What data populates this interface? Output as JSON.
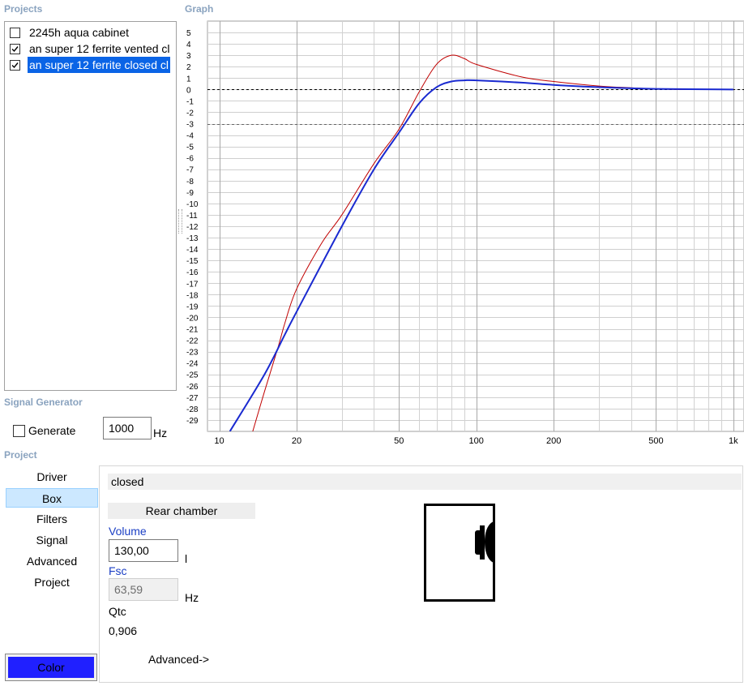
{
  "sections": {
    "projects": "Projects",
    "graph": "Graph",
    "signal_generator": "Signal Generator",
    "project": "Project"
  },
  "projects": [
    {
      "label": "2245h aqua cabinet",
      "checked": false,
      "selected": false
    },
    {
      "label": "an super 12 ferrite vented cl",
      "checked": true,
      "selected": false
    },
    {
      "label": "an super 12 ferrite closed cl",
      "checked": true,
      "selected": true
    }
  ],
  "signal": {
    "generate_label": "Generate",
    "frequency": "1000",
    "unit": "Hz"
  },
  "nav": {
    "items": [
      "Driver",
      "Box",
      "Filters",
      "Signal",
      "Advanced",
      "Project"
    ],
    "active": "Box",
    "color_button": "Color",
    "color_button_bg": "#2020ff"
  },
  "box": {
    "name": "closed",
    "rear_chamber_label": "Rear chamber",
    "volume_label": "Volume",
    "volume_value": "130,00",
    "volume_unit": "l",
    "fsc_label": "Fsc",
    "fsc_value": "63,59",
    "fsc_unit": "Hz",
    "qtc_label": "Qtc",
    "qtc_value": "0,906",
    "advanced_link": "Advanced->"
  },
  "chart_data": {
    "type": "line",
    "title": "",
    "xlabel": "",
    "ylabel": "",
    "x_scale": "log",
    "xlim": [
      9,
      1100
    ],
    "ylim": [
      -30,
      6
    ],
    "x_ticks": [
      10,
      20,
      50,
      100,
      200,
      500,
      1000
    ],
    "x_tick_labels": [
      "10",
      "20",
      "50",
      "100",
      "200",
      "500",
      "1k"
    ],
    "y_ticks": [
      5,
      4,
      3,
      2,
      1,
      0,
      -1,
      -2,
      -3,
      -4,
      -5,
      -6,
      -7,
      -8,
      -9,
      -10,
      -11,
      -12,
      -13,
      -14,
      -15,
      -16,
      -17,
      -18,
      -19,
      -20,
      -21,
      -22,
      -23,
      -24,
      -25,
      -26,
      -27,
      -28,
      -29
    ],
    "reference_lines_y": [
      0,
      -3
    ],
    "grid": true,
    "series": [
      {
        "color": "#c00000",
        "x": [
          13.5,
          15,
          17,
          18,
          20,
          25,
          30,
          40,
          50,
          60,
          70,
          80,
          90,
          100,
          150,
          200,
          300,
          400,
          600,
          1000
        ],
        "y": [
          -30,
          -26.5,
          -22.5,
          -20.5,
          -17.5,
          -13.5,
          -11,
          -6.5,
          -3.5,
          -0.2,
          2.2,
          3,
          2.7,
          2.2,
          1.1,
          0.7,
          0.3,
          0.15,
          0,
          0
        ]
      },
      {
        "color": "#1a2ad0",
        "x": [
          11,
          15,
          18,
          20,
          30,
          40,
          50,
          60,
          70,
          80,
          90,
          100,
          150,
          200,
          300,
          500,
          1000
        ],
        "y": [
          -30,
          -25,
          -21.5,
          -19.5,
          -12,
          -7,
          -3.8,
          -1.2,
          0.2,
          0.7,
          0.8,
          0.8,
          0.6,
          0.4,
          0.2,
          0.05,
          0
        ]
      }
    ]
  }
}
